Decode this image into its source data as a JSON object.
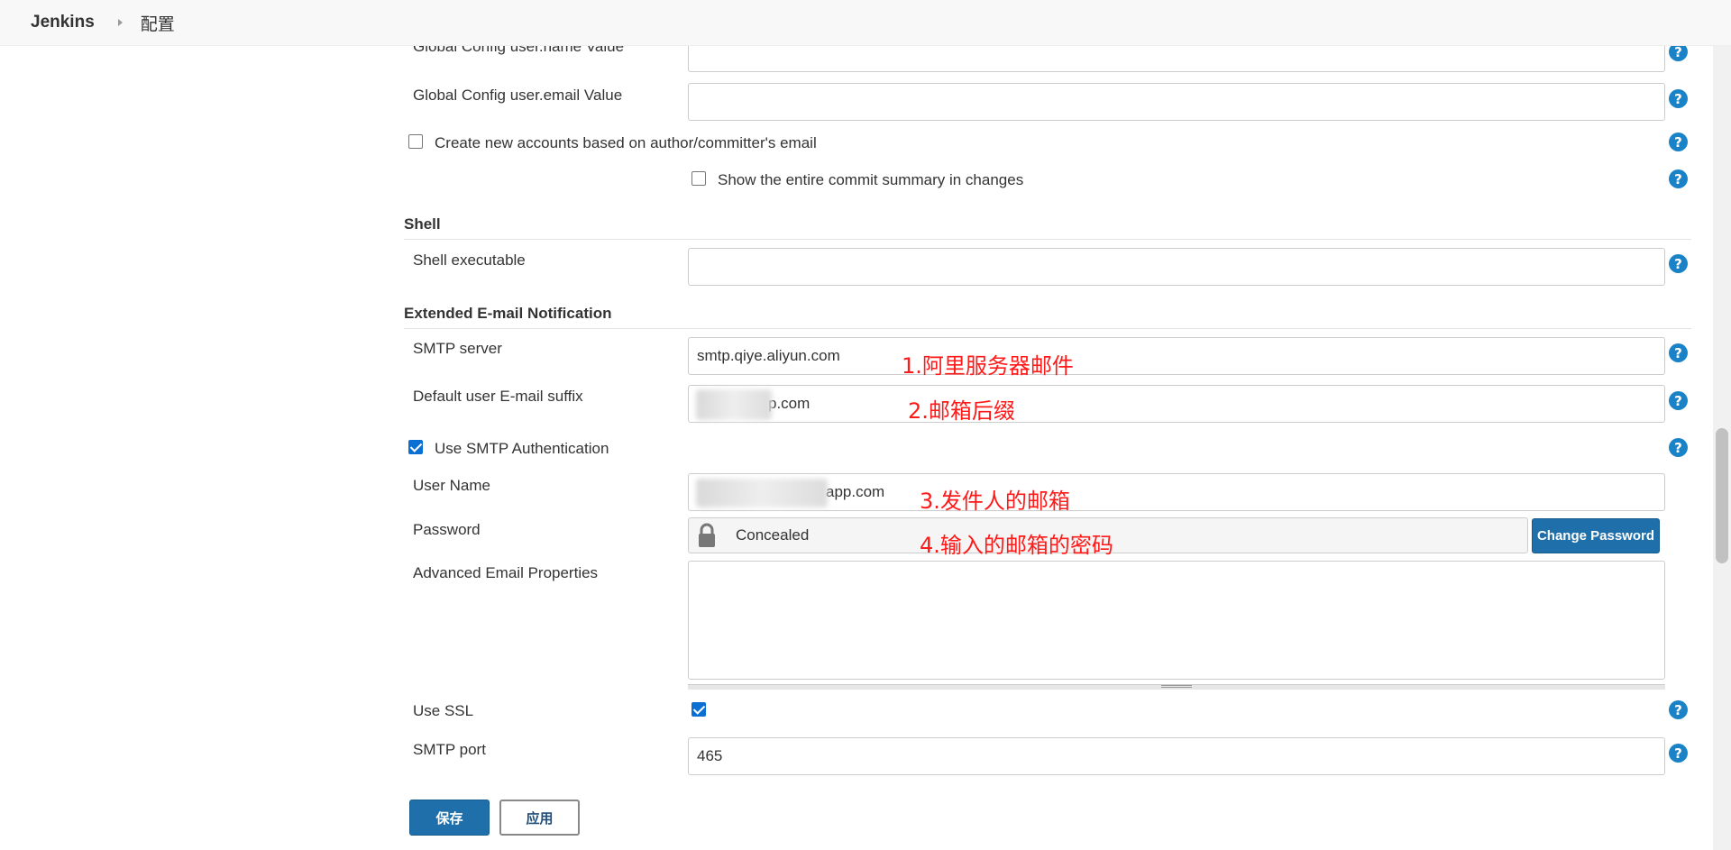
{
  "breadcrumb": {
    "app": "Jenkins",
    "page": "配置"
  },
  "git": {
    "user_name_label": "Global Config user.name Value",
    "user_email_label": "Global Config user.email Value",
    "create_accounts_label": "Create new accounts based on author/committer's email",
    "show_summary_label": "Show the entire commit summary in changes"
  },
  "shell": {
    "title": "Shell",
    "executable_label": "Shell executable"
  },
  "email": {
    "title": "Extended E-mail Notification",
    "smtp_server_label": "SMTP server",
    "smtp_server_value": "smtp.qiye.aliyun.com",
    "suffix_label": "Default user E-mail suffix",
    "suffix_value": "p.com",
    "use_auth_label": "Use SMTP Authentication",
    "user_name_label": "User Name",
    "user_name_value": "app.com",
    "password_label": "Password",
    "password_value": "Concealed",
    "change_password_label": "Change Password",
    "advanced_label": "Advanced Email Properties",
    "use_ssl_label": "Use SSL",
    "smtp_port_label": "SMTP port",
    "smtp_port_value": "465"
  },
  "annotations": {
    "a1": "1.阿里服务器邮件",
    "a2": "2.邮箱后缀",
    "a3": "3.发件人的邮箱",
    "a4": "4.输入的邮箱的密码"
  },
  "buttons": {
    "save": "保存",
    "apply": "应用"
  },
  "icons": {
    "help": "?",
    "lock": "lock-icon",
    "breadcrumb_separator": "chevron-right-icon"
  },
  "colors": {
    "help": "#1a83c8",
    "primary_button": "#1f6faa",
    "annotation": "#ff1a1a",
    "checkbox": "#0b6fd4"
  }
}
